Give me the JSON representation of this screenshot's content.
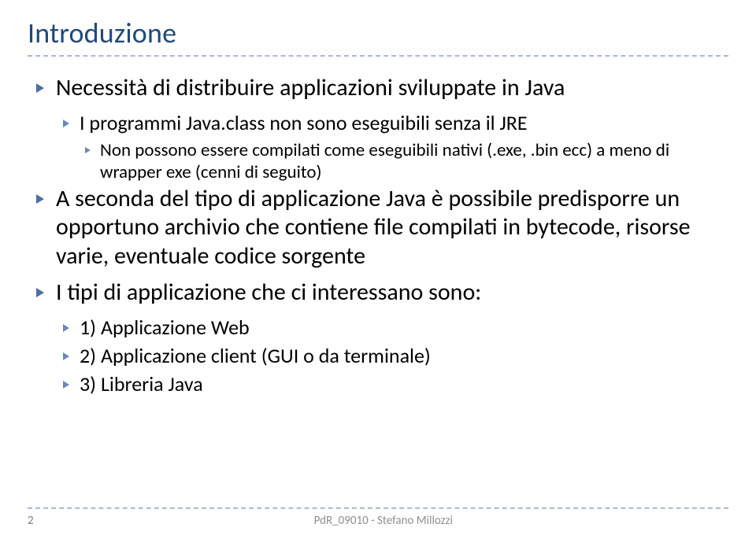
{
  "title": "Introduzione",
  "bullets": {
    "b1": "Necessità di distribuire applicazioni sviluppate in Java",
    "b1_1": "I programmi Java.class non sono eseguibili senza il JRE",
    "b1_1_1": "Non possono essere compilati come eseguibili nativi (.exe, .bin ecc) a meno di wrapper exe (cenni di seguito)",
    "b2": "A seconda del tipo di applicazione Java è possibile predisporre un opportuno archivio che contiene file compilati in bytecode, risorse varie, eventuale codice sorgente",
    "b3": "I tipi di applicazione che ci interessano sono:",
    "b3_1": "1) Applicazione Web",
    "b3_2": "2) Applicazione client (GUI o da terminale)",
    "b3_3": "3) Libreria Java"
  },
  "footer": {
    "page": "2",
    "text": "PdR_09010 - Stefano Millozzi"
  }
}
